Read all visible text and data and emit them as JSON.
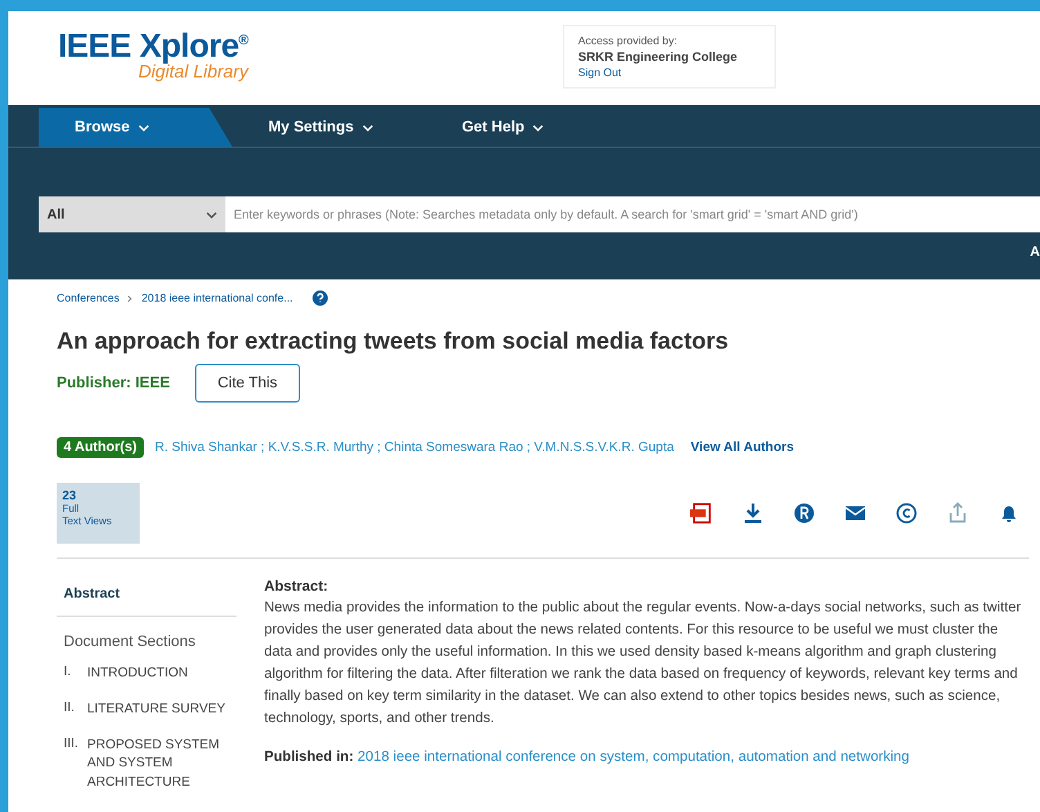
{
  "logo": {
    "name": "IEEE Xplore",
    "mark": "®",
    "subtitle": "Digital Library"
  },
  "access": {
    "label": "Access provided by:",
    "institution": "SRKR Engineering College",
    "sign_out": "Sign Out"
  },
  "nav": [
    {
      "label": "Browse",
      "selected": true
    },
    {
      "label": "My Settings",
      "selected": false
    },
    {
      "label": "Get Help",
      "selected": false
    }
  ],
  "search": {
    "scope": "All",
    "placeholder": "Enter keywords or phrases (Note: Searches metadata only by default. A search for 'smart grid' = 'smart AND grid')",
    "cut_link": "A"
  },
  "breadcrumb": [
    "Conferences",
    "2018 ieee international confe..."
  ],
  "title": "An approach for extracting tweets from social media factors",
  "publisher": "Publisher: IEEE",
  "cite": "Cite This",
  "authors_badge": "4 Author(s)",
  "authors": "R. Shiva Shankar ; K.V.S.S.R. Murthy ; Chinta Someswara Rao ; V.M.N.S.S.V.K.R. Gupta",
  "view_all": "View All Authors",
  "metrics": {
    "count": "23",
    "label_1": "Full",
    "label_2": "Text Views"
  },
  "actions": [
    {
      "kind": "pdf"
    },
    {
      "kind": "download"
    },
    {
      "kind": "rights"
    },
    {
      "kind": "email"
    },
    {
      "kind": "copyright"
    },
    {
      "kind": "share"
    },
    {
      "kind": "alert"
    }
  ],
  "sidebar": {
    "active": "Abstract",
    "heading": "Document Sections",
    "sections": [
      {
        "num": "I.",
        "title": "INTRODUCTION"
      },
      {
        "num": "II.",
        "title": "LITERATURE SURVEY"
      },
      {
        "num": "III.",
        "title": "PROPOSED SYSTEM AND SYSTEM ARCHITECTURE"
      }
    ]
  },
  "abstract": {
    "heading": "Abstract:",
    "text": "News media provides the information to the public about the regular events. Now-a-days social networks, such as twitter provides the user generated data about the news related contents. For this resource to be useful we must cluster the data and provides only the useful information. In this we used density based k-means algorithm and graph clustering algorithm for filtering the data. After filteration we rank the data based on frequency of keywords, relevant key terms and finally based on key term similarity in the dataset. We can also extend to other topics besides news, such as science, technology, sports, and other trends.",
    "published_label": "Published in:",
    "published": "2018 ieee international conference on system, computation, automation and networking"
  }
}
